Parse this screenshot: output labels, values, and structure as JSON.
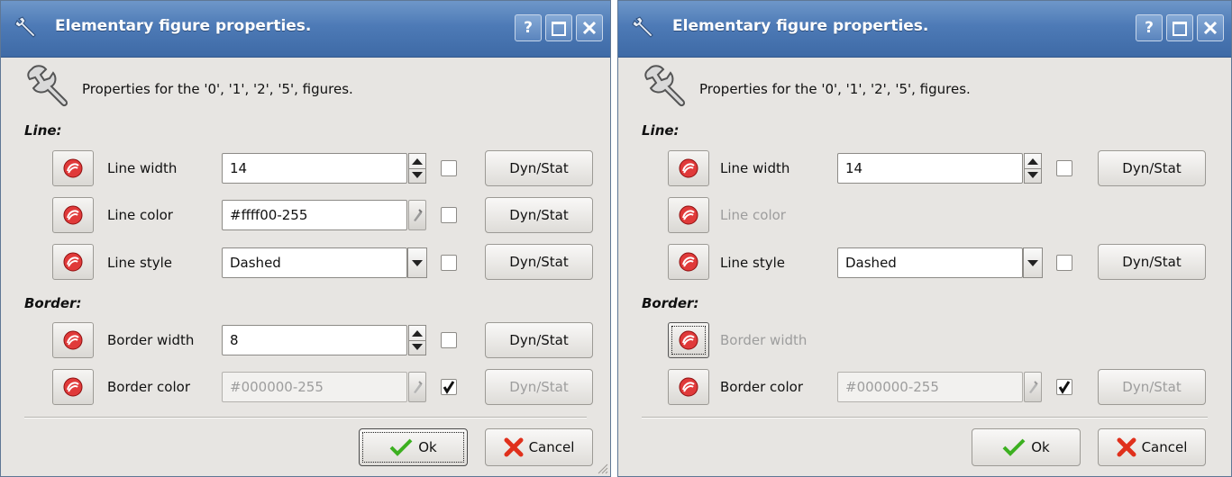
{
  "dialogs": [
    {
      "title": "Elementary figure properties.",
      "info": "Properties for the '0', '1', '2', '5',  figures.",
      "line_section": "Line:",
      "border_section": "Border:",
      "line_width": {
        "label": "Line width",
        "value": "14"
      },
      "line_color": {
        "label": "Line color",
        "value": "#ffff00-255"
      },
      "line_style": {
        "label": "Line style",
        "value": "Dashed"
      },
      "border_width": {
        "label": "Border width",
        "value": "8"
      },
      "border_color": {
        "label": "Border color",
        "value": "#000000-255"
      },
      "dyn_label": "Dyn/Stat",
      "ok_label": "Ok",
      "cancel_label": "Cancel",
      "titlebar_buttons": {
        "help": "?"
      }
    },
    {
      "title": "Elementary figure properties.",
      "info": "Properties for the '0', '1', '2', '5',  figures.",
      "line_section": "Line:",
      "border_section": "Border:",
      "line_width": {
        "label": "Line width",
        "value": "14"
      },
      "line_color": {
        "label": "Line color"
      },
      "line_style": {
        "label": "Line style",
        "value": "Dashed"
      },
      "border_width": {
        "label": "Border width"
      },
      "border_color": {
        "label": "Border color",
        "value": "#000000-255"
      },
      "dyn_label": "Dyn/Stat",
      "ok_label": "Ok",
      "cancel_label": "Cancel",
      "titlebar_buttons": {
        "help": "?"
      }
    }
  ],
  "colors": {
    "titlebar": "#4d7ab6",
    "dialog_bg": "#e7e5e2",
    "disabled_text": "#9d9d9d",
    "ok_check": "#3cb020",
    "cancel_x": "#e0301c"
  },
  "icons": [
    "wrench-icon",
    "help-icon",
    "maximize-icon",
    "close-icon",
    "reset-icon",
    "color-picker-icon",
    "checkmark-icon",
    "cancel-x-icon",
    "resize-grip-icon"
  ]
}
